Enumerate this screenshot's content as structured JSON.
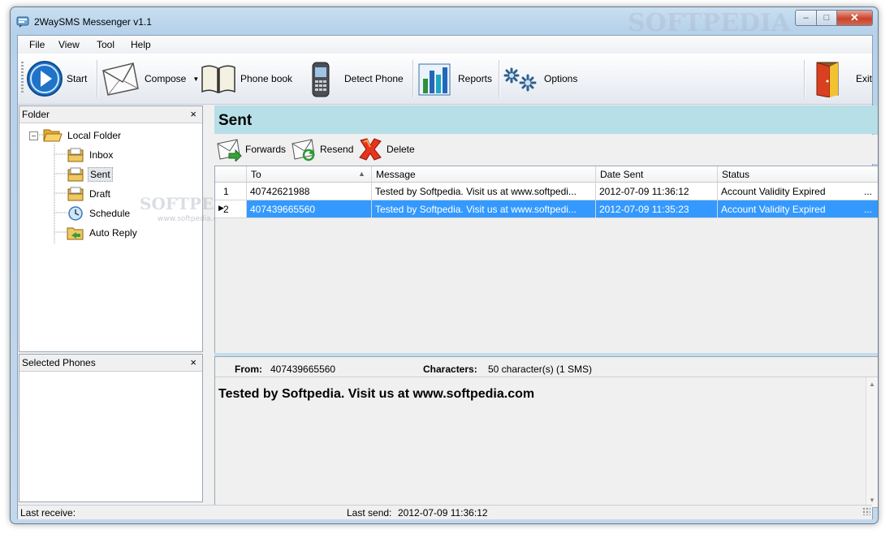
{
  "window": {
    "title": "2WaySMS Messenger v1.1"
  },
  "menu": [
    "File",
    "View",
    "Tool",
    "Help"
  ],
  "toolbar": {
    "start": "Start",
    "compose": "Compose",
    "phonebook": "Phone book",
    "detect": "Detect Phone",
    "reports": "Reports",
    "options": "Options",
    "exit": "Exit"
  },
  "folder_panel": {
    "title": "Folder",
    "root": "Local Folder",
    "items": [
      "Inbox",
      "Sent",
      "Draft",
      "Schedule",
      "Auto Reply"
    ],
    "selected": "Sent"
  },
  "phones_panel": {
    "title": "Selected Phones"
  },
  "main": {
    "heading": "Sent",
    "actions": {
      "forwards": "Forwards",
      "resend": "Resend",
      "delete": "Delete"
    },
    "columns": [
      "To",
      "Message",
      "Date Sent",
      "Status"
    ],
    "rows": [
      {
        "num": "1",
        "to": "40742621988",
        "message": "Tested by Softpedia. Visit us at www.softpedi...",
        "date": "2012-07-09 11:36:12",
        "status": "Account Validity Expired",
        "more": "..."
      },
      {
        "num": "2",
        "to": "407439665560",
        "message": "Tested by Softpedia. Visit us at www.softpedi...",
        "date": "2012-07-09 11:35:23",
        "status": "Account Validity Expired",
        "more": "..."
      }
    ]
  },
  "detail": {
    "from_label": "From:",
    "from_value": "407439665560",
    "chars_label": "Characters:",
    "chars_value": "50 character(s) (1 SMS)",
    "message": "Tested by Softpedia. Visit us at www.softpedia.com"
  },
  "status": {
    "last_receive_label": "Last receive:",
    "last_send_label": "Last send:",
    "last_send_value": "2012-07-09 11:36:12"
  },
  "watermarks": {
    "title": "SOFTPEDIA",
    "mid": "SOFTPEDIA",
    "url": "www.softpedia.com"
  }
}
